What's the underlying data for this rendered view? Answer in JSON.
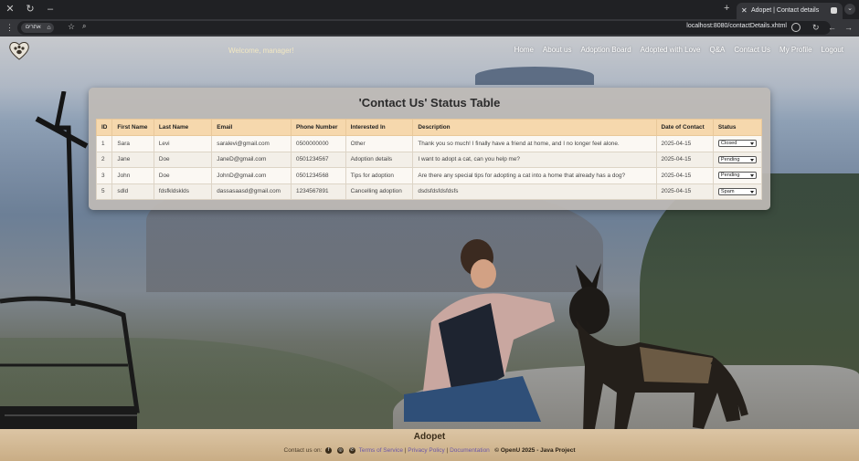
{
  "browser": {
    "tab_title": "Adopet | Contact details",
    "url": "localhost:8080/contactDetails.xhtml",
    "site_chip": "אתרים"
  },
  "navbar": {
    "welcome": "Welcome, manager!",
    "links": [
      "Home",
      "About us",
      "Adoption Board",
      "Adopted with Love",
      "Q&A",
      "Contact Us",
      "My Profile",
      "Logout"
    ]
  },
  "table": {
    "title": "'Contact Us' Status Table",
    "columns": [
      "ID",
      "First Name",
      "Last Name",
      "Email",
      "Phone Number",
      "Interested In",
      "Description",
      "Date of Contact",
      "Status"
    ],
    "rows": [
      {
        "id": "1",
        "first": "Sara",
        "last": "Levi",
        "email": "saralevi@gmail.com",
        "phone": "0500000000",
        "interest": "Other",
        "description": "Thank you so much! I finally have a friend at home, and I no longer feel alone.",
        "date": "2025-04-15",
        "status": "Closed"
      },
      {
        "id": "2",
        "first": "Jane",
        "last": "Doe",
        "email": "JaneD@gmail.com",
        "phone": "0501234567",
        "interest": "Adoption details",
        "description": "I want to adopt a cat, can you help me?",
        "date": "2025-04-15",
        "status": "Pending"
      },
      {
        "id": "3",
        "first": "John",
        "last": "Doe",
        "email": "JohnD@gmail.com",
        "phone": "0501234568",
        "interest": "Tips for adoption",
        "description": "Are there any special tips for adopting a cat into a home that already has a dog?",
        "date": "2025-04-15",
        "status": "Pending"
      },
      {
        "id": "5",
        "first": "sdld",
        "last": "fdsfkldsklds",
        "email": "dassasaasd@gmail.com",
        "phone": "1234567891",
        "interest": "Cancelling adoption",
        "description": "dsdsfdsfdsfdsfs",
        "date": "2025-04-15",
        "status": "Spam"
      }
    ]
  },
  "footer": {
    "brand": "Adopet",
    "contact_label": "Contact us on:",
    "terms": "Terms of Service",
    "privacy": "Privacy Policy",
    "docs": "Documentation",
    "copyright": "© OpenU 2025 - Java Project"
  }
}
